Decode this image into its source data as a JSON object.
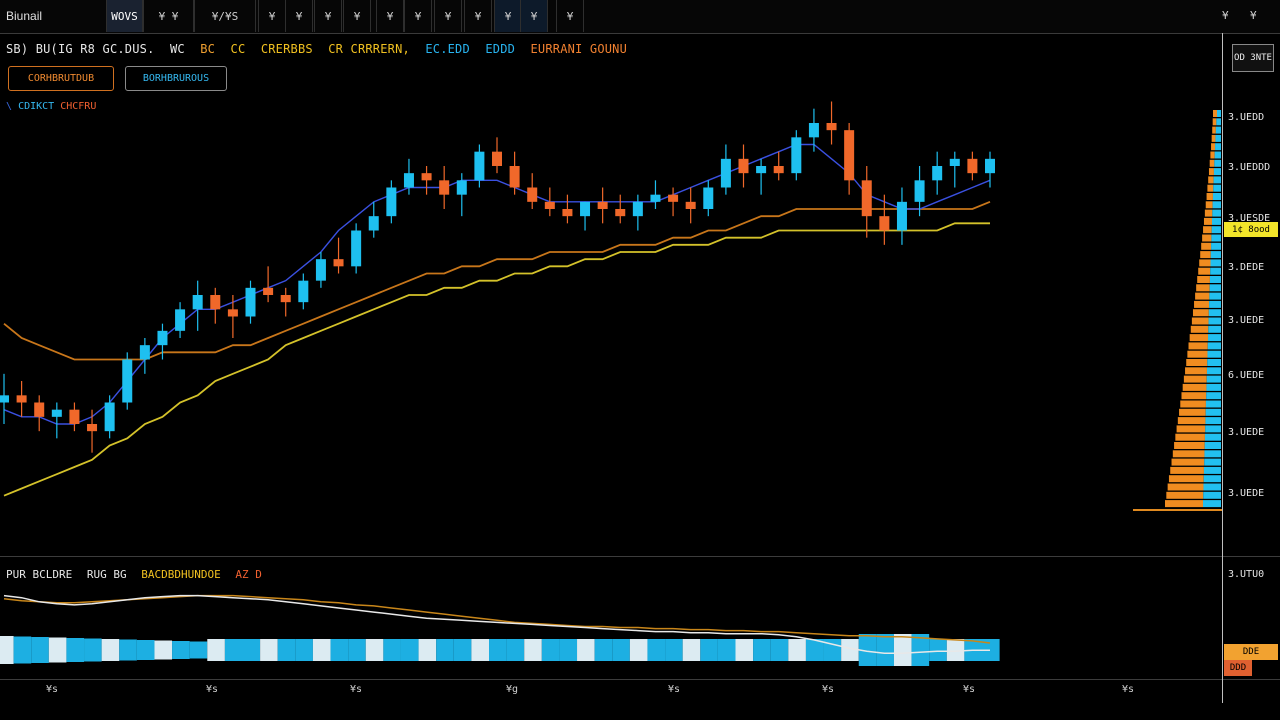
{
  "toolbar": {
    "brand": "Biunail",
    "buttons": [
      "WOVS",
      "¥ ¥",
      "¥/¥S",
      "¥",
      "¥",
      "¥",
      "¥",
      "¥",
      "¥",
      "¥",
      "¥",
      "¥",
      "¥",
      "¥"
    ],
    "right": [
      "¥",
      "¥"
    ]
  },
  "header": {
    "symbol": "SB) BU(IG R8 GC.DUS.",
    "interval": "WC",
    "tag1": "BC",
    "tag2": "CC",
    "name1": "CRERBBS",
    "name2": "CR CRRRERN,",
    "value1": "EC.EDD",
    "value2": "EDDD",
    "status": "EURRANI GOUNU"
  },
  "buttons": {
    "left": "CORHBRUTDUB",
    "right": "BORHBRUROUS"
  },
  "legend": {
    "marker": "\\",
    "text1": "CDIKCT",
    "text2": "CHCFRU"
  },
  "price_scale": [
    "3.UEDD",
    "3.UEDDD",
    "3.UESDE",
    "3.DEDE",
    "3.UEDE",
    "6.UEDE",
    "3.UEDE",
    "3.UEDE"
  ],
  "price_tag": "1¢ 8ood",
  "top_box": "OD\n3NTE",
  "osc": {
    "title1": "PUR BCLDRE",
    "title2": "RUG BG",
    "title3": "BACDBDHUNDOE",
    "title4": "AZ D",
    "scale": "3.UTU0",
    "tag1": "DDE",
    "tag2": "DDD"
  },
  "x_axis": [
    "¥s",
    "¥s",
    "¥s",
    "¥g",
    "¥s",
    "¥s",
    "¥s",
    "¥s"
  ],
  "colors": {
    "up": "#1ec0f0",
    "down": "#f0682a",
    "fast_ma": "#3a50e0",
    "mid_ma": "#c8761a",
    "slow_ma": "#d4c22a",
    "accent": "#f2e52a"
  },
  "chart_data": {
    "type": "candlestick",
    "series": [
      {
        "name": "candles",
        "values": [
          [
            95,
            99,
            92,
            96
          ],
          [
            96,
            98,
            93,
            95
          ],
          [
            95,
            96,
            91,
            93
          ],
          [
            93,
            95,
            90,
            94
          ],
          [
            94,
            95,
            91,
            92
          ],
          [
            92,
            94,
            88,
            91
          ],
          [
            91,
            96,
            90,
            95
          ],
          [
            95,
            102,
            94,
            101
          ],
          [
            101,
            104,
            99,
            103
          ],
          [
            103,
            106,
            101,
            105
          ],
          [
            105,
            109,
            104,
            108
          ],
          [
            108,
            112,
            105,
            110
          ],
          [
            110,
            111,
            106,
            108
          ],
          [
            108,
            110,
            104,
            107
          ],
          [
            107,
            112,
            106,
            111
          ],
          [
            111,
            114,
            109,
            110
          ],
          [
            110,
            111,
            107,
            109
          ],
          [
            109,
            113,
            108,
            112
          ],
          [
            112,
            116,
            111,
            115
          ],
          [
            115,
            118,
            113,
            114
          ],
          [
            114,
            120,
            113,
            119
          ],
          [
            119,
            123,
            118,
            121
          ],
          [
            121,
            126,
            120,
            125
          ],
          [
            125,
            129,
            124,
            127
          ],
          [
            127,
            128,
            124,
            126
          ],
          [
            126,
            128,
            122,
            124
          ],
          [
            124,
            127,
            121,
            126
          ],
          [
            126,
            131,
            125,
            130
          ],
          [
            130,
            132,
            127,
            128
          ],
          [
            128,
            130,
            124,
            125
          ],
          [
            125,
            127,
            122,
            123
          ],
          [
            123,
            125,
            121,
            122
          ],
          [
            122,
            124,
            120,
            121
          ],
          [
            121,
            123,
            119,
            123
          ],
          [
            123,
            125,
            120,
            122
          ],
          [
            122,
            124,
            120,
            121
          ],
          [
            121,
            124,
            119,
            123
          ],
          [
            123,
            126,
            122,
            124
          ],
          [
            124,
            125,
            121,
            123
          ],
          [
            123,
            125,
            120,
            122
          ],
          [
            122,
            126,
            121,
            125
          ],
          [
            125,
            131,
            124,
            129
          ],
          [
            129,
            131,
            125,
            127
          ],
          [
            127,
            129,
            124,
            128
          ],
          [
            128,
            130,
            126,
            127
          ],
          [
            127,
            133,
            126,
            132
          ],
          [
            132,
            136,
            130,
            134
          ],
          [
            134,
            137,
            131,
            133
          ],
          [
            133,
            134,
            124,
            126
          ],
          [
            126,
            128,
            118,
            121
          ],
          [
            121,
            124,
            117,
            119
          ],
          [
            119,
            125,
            117,
            123
          ],
          [
            123,
            128,
            121,
            126
          ],
          [
            126,
            130,
            124,
            128
          ],
          [
            128,
            130,
            125,
            129
          ],
          [
            129,
            130,
            126,
            127
          ],
          [
            127,
            130,
            125,
            129
          ]
        ]
      },
      {
        "name": "ma_fast",
        "values": [
          94,
          93,
          93,
          92,
          92,
          93,
          95,
          98,
          101,
          104,
          106,
          108,
          108,
          109,
          110,
          111,
          112,
          114,
          116,
          119,
          121,
          123,
          124,
          125,
          125,
          125,
          126,
          126,
          126,
          125,
          124,
          123,
          123,
          123,
          123,
          123,
          123,
          123,
          124,
          125,
          126,
          127,
          128,
          129,
          130,
          131,
          131,
          129,
          127,
          124,
          123,
          122,
          122,
          123,
          124,
          125,
          126
        ]
      },
      {
        "name": "ma_mid",
        "values": [
          106,
          104,
          103,
          102,
          101,
          101,
          101,
          101,
          101,
          102,
          102,
          102,
          102,
          103,
          103,
          104,
          105,
          106,
          107,
          108,
          109,
          110,
          111,
          112,
          113,
          113,
          114,
          114,
          115,
          115,
          115,
          116,
          116,
          116,
          116,
          117,
          117,
          117,
          118,
          118,
          119,
          119,
          120,
          121,
          121,
          122,
          122,
          122,
          122,
          122,
          122,
          122,
          122,
          122,
          122,
          122,
          123
        ]
      },
      {
        "name": "ma_slow",
        "values": [
          82,
          83,
          84,
          85,
          86,
          87,
          89,
          90,
          92,
          93,
          95,
          96,
          98,
          99,
          100,
          101,
          103,
          104,
          105,
          106,
          107,
          108,
          109,
          110,
          110,
          111,
          111,
          112,
          112,
          113,
          113,
          114,
          114,
          115,
          115,
          116,
          116,
          116,
          117,
          117,
          117,
          118,
          118,
          118,
          119,
          119,
          119,
          119,
          119,
          119,
          119,
          119,
          119,
          119,
          120,
          120,
          120
        ]
      }
    ],
    "oscillator": {
      "line1": [
        80,
        78,
        74,
        72,
        71,
        72,
        74,
        76,
        78,
        79,
        80,
        80,
        79,
        78,
        77,
        76,
        74,
        72,
        70,
        68,
        66,
        64,
        62,
        60,
        58,
        57,
        56,
        55,
        54,
        53,
        52,
        51,
        50,
        49,
        48,
        47,
        46,
        45,
        45,
        44,
        44,
        43,
        43,
        43,
        42,
        40,
        37,
        33,
        29,
        26,
        24,
        24,
        25,
        26,
        26,
        27,
        27
      ],
      "line2": [
        77,
        75,
        74,
        73,
        73,
        74,
        75,
        76,
        77,
        78,
        79,
        80,
        80,
        80,
        79,
        78,
        77,
        76,
        74,
        73,
        71,
        70,
        68,
        66,
        64,
        62,
        60,
        58,
        56,
        54,
        53,
        52,
        51,
        50,
        50,
        49,
        49,
        48,
        48,
        47,
        47,
        46,
        46,
        45,
        45,
        44,
        43,
        42,
        41,
        41,
        40,
        40,
        39,
        38,
        37,
        36,
        34
      ]
    }
  }
}
